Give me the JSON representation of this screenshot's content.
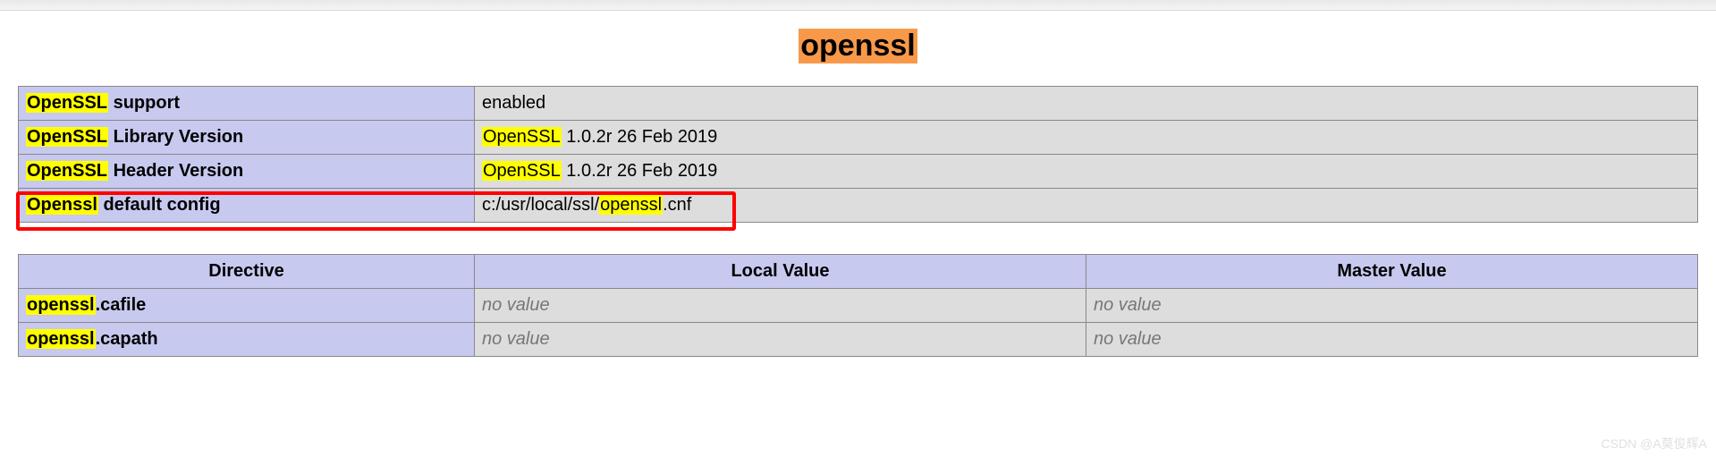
{
  "header": {
    "title": "openssl"
  },
  "info_rows": [
    {
      "label_highlight": "OpenSSL",
      "label_rest": " support",
      "value_highlight": "",
      "value_rest": "enabled",
      "highlighted": false
    },
    {
      "label_highlight": "OpenSSL",
      "label_rest": " Library Version",
      "value_highlight": "OpenSSL",
      "value_rest": " 1.0.2r 26 Feb 2019",
      "highlighted": false
    },
    {
      "label_highlight": "OpenSSL",
      "label_rest": " Header Version",
      "value_highlight": "OpenSSL",
      "value_rest": " 1.0.2r 26 Feb 2019",
      "highlighted": false
    },
    {
      "label_highlight": "Openssl",
      "label_rest": " default config",
      "value_prefix": "c:/usr/local/ssl/",
      "value_highlight": "openssl",
      "value_rest": ".cnf",
      "highlighted": true
    }
  ],
  "settings_headers": {
    "directive": "Directive",
    "local": "Local Value",
    "master": "Master Value"
  },
  "settings_rows": [
    {
      "name_highlight": "openssl",
      "name_rest": ".cafile",
      "local": "no value",
      "master": "no value"
    },
    {
      "name_highlight": "openssl",
      "name_rest": ".capath",
      "local": "no value",
      "master": "no value"
    }
  ],
  "watermark": "CSDN @A莫俊辉A"
}
